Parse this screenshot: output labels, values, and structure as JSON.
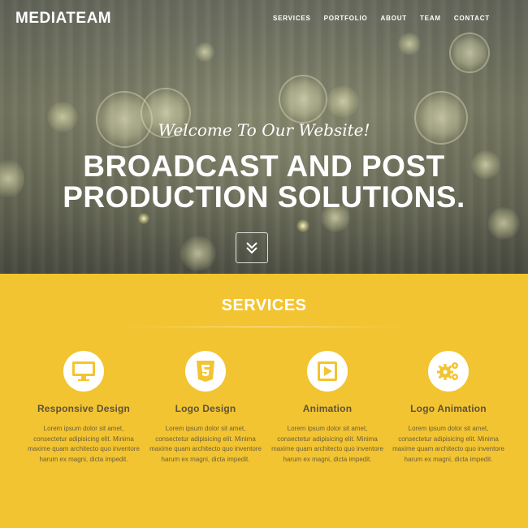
{
  "nav": {
    "logo": "MEDIATEAM",
    "items": [
      "SERVICES",
      "PORTFOLIO",
      "ABOUT",
      "TEAM",
      "CONTACT"
    ]
  },
  "hero": {
    "welcome": "Welcome To Our Website!",
    "headline_line1": "BROADCAST AND POST",
    "headline_line2": "PRODUCTION SOLUTIONS."
  },
  "services": {
    "title": "SERVICES",
    "items": [
      {
        "title": "Responsive Design",
        "icon": "monitor-icon",
        "text": "Lorem ipsum dolor sit amet, consectetur adipisicing elit. Minima maxime quam architecto quo inventore harum ex magni, dicta impedit."
      },
      {
        "title": "Logo Design",
        "icon": "html5-icon",
        "text": "Lorem ipsum dolor sit amet, consectetur adipisicing elit. Minima maxime quam architecto quo inventore harum ex magni, dicta impedit."
      },
      {
        "title": "Animation",
        "icon": "play-icon",
        "text": "Lorem ipsum dolor sit amet, consectetur adipisicing elit. Minima maxime quam architecto quo inventore harum ex magni, dicta impedit."
      },
      {
        "title": "Logo Animation",
        "icon": "gears-icon",
        "text": "Lorem ipsum dolor sit amet, consectetur adipisicing elit. Minima maxime quam architecto quo inventore harum ex magni, dicta impedit."
      }
    ]
  },
  "colors": {
    "accent": "#f3c431",
    "text_dark": "#5d5438"
  }
}
